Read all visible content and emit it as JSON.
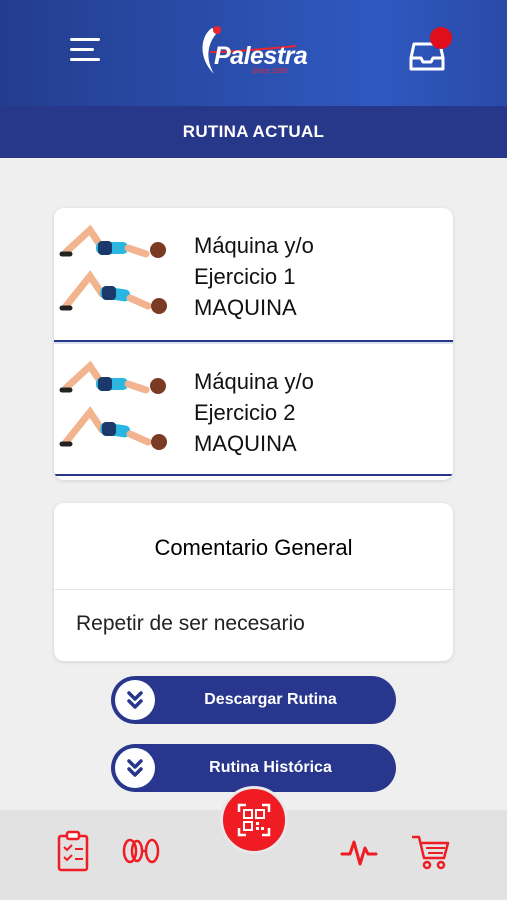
{
  "header": {
    "logo_text": "Palestra",
    "logo_tagline": "Since 1993",
    "menu_icon": "hamburger-menu-icon",
    "inbox_icon": "inbox-icon"
  },
  "subheader": {
    "title": "RUTINA ACTUAL"
  },
  "exercises": [
    {
      "line1": "Máquina y/o",
      "line2": "Ejercicio 1",
      "line3": "MAQUINA",
      "thumb": "glute-bridge-illustration"
    },
    {
      "line1": "Máquina y/o",
      "line2": "Ejercicio 2",
      "line3": "MAQUINA",
      "thumb": "glute-bridge-illustration"
    }
  ],
  "comment": {
    "title": "Comentario General",
    "body": "Repetir de ser necesario"
  },
  "actions": {
    "download_label": "Descargar Rutina",
    "history_label": "Rutina Histórica"
  },
  "bottom_nav": {
    "items": [
      "clipboard-checklist-icon",
      "weights-icon",
      "qr-code-icon",
      "heartbeat-icon",
      "shopping-cart-icon"
    ]
  },
  "colors": {
    "header_blue": "#2f59c0",
    "navy": "#27378a",
    "accent_red": "#ef1c24",
    "background": "#efefef"
  }
}
